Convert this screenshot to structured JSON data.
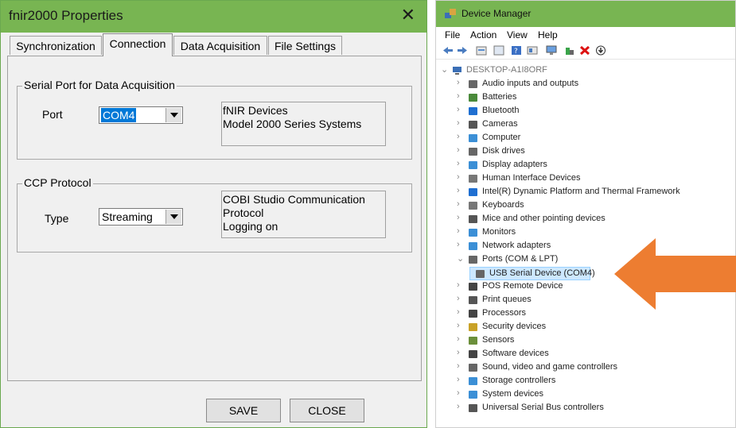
{
  "dialog": {
    "title": "fnir2000 Properties",
    "close_glyph": "✕",
    "tabs": [
      "Synchronization",
      "Connection",
      "Data Acquisition",
      "File Settings"
    ],
    "active_tab": "Connection",
    "serial_group": {
      "legend": "Serial Port for Data Acquisition",
      "port_label": "Port",
      "port_value": "COM4",
      "info_lines": [
        "fNIR Devices",
        "Model 2000 Series Systems"
      ]
    },
    "ccp_group": {
      "legend": "CCP Protocol",
      "type_label": "Type",
      "type_value": "Streaming",
      "info_lines": [
        "COBI Studio Communication",
        "Protocol",
        "Logging on"
      ]
    },
    "save_label": "SAVE",
    "close_label": "CLOSE"
  },
  "device_manager": {
    "title": "Device Manager",
    "menu": [
      "File",
      "Action",
      "View",
      "Help"
    ],
    "root": "DESKTOP-A1I8ORF",
    "items": [
      {
        "label": "Audio inputs and outputs",
        "icon": "speaker-icon",
        "expanded": false
      },
      {
        "label": "Batteries",
        "icon": "battery-icon",
        "expanded": false
      },
      {
        "label": "Bluetooth",
        "icon": "bluetooth-icon",
        "expanded": false
      },
      {
        "label": "Cameras",
        "icon": "camera-icon",
        "expanded": false
      },
      {
        "label": "Computer",
        "icon": "computer-icon",
        "expanded": false
      },
      {
        "label": "Disk drives",
        "icon": "disk-icon",
        "expanded": false
      },
      {
        "label": "Display adapters",
        "icon": "display-adapter-icon",
        "expanded": false
      },
      {
        "label": "Human Interface Devices",
        "icon": "hid-icon",
        "expanded": false
      },
      {
        "label": "Intel(R) Dynamic Platform and Thermal Framework",
        "icon": "intel-icon",
        "expanded": false
      },
      {
        "label": "Keyboards",
        "icon": "keyboard-icon",
        "expanded": false
      },
      {
        "label": "Mice and other pointing devices",
        "icon": "mouse-icon",
        "expanded": false
      },
      {
        "label": "Monitors",
        "icon": "monitor-icon",
        "expanded": false
      },
      {
        "label": "Network adapters",
        "icon": "network-icon",
        "expanded": false
      },
      {
        "label": "Ports (COM & LPT)",
        "icon": "port-icon",
        "expanded": true
      },
      {
        "label": "USB Serial Device (COM4)",
        "icon": "usb-serial-icon",
        "child": true,
        "selected": true
      },
      {
        "label": "POS Remote Device",
        "icon": "pos-icon",
        "expanded": false
      },
      {
        "label": "Print queues",
        "icon": "printer-icon",
        "expanded": false
      },
      {
        "label": "Processors",
        "icon": "processor-icon",
        "expanded": false
      },
      {
        "label": "Security devices",
        "icon": "security-icon",
        "expanded": false
      },
      {
        "label": "Sensors",
        "icon": "sensor-icon",
        "expanded": false
      },
      {
        "label": "Software devices",
        "icon": "software-icon",
        "expanded": false
      },
      {
        "label": "Sound, video and game controllers",
        "icon": "sound-icon",
        "expanded": false
      },
      {
        "label": "Storage controllers",
        "icon": "storage-icon",
        "expanded": false
      },
      {
        "label": "System devices",
        "icon": "system-icon",
        "expanded": false
      },
      {
        "label": "Universal Serial Bus controllers",
        "icon": "usb-icon",
        "expanded": false
      }
    ]
  },
  "colors": {
    "title_bar": "#78b552",
    "arrow": "#ed7d31",
    "selection": "#cde8ff",
    "combo_highlight": "#0078d7"
  }
}
